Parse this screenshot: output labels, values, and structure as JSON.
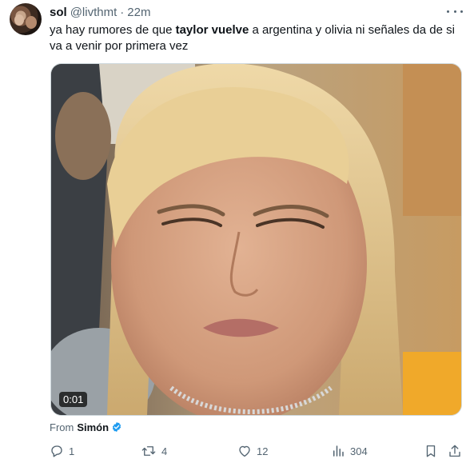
{
  "tweet": {
    "display_name": "sol",
    "handle": "@livthmt",
    "separator": "·",
    "time": "22m",
    "text": {
      "part1": "ya hay rumores de que ",
      "bold": "taylor vuelve",
      "part2": " a argentina y olivia ni señales da de si va a venir por primera vez"
    },
    "media": {
      "duration": "0:01"
    },
    "from": {
      "prefix": "From",
      "source": "Simón"
    },
    "actions": {
      "replies": "1",
      "reposts": "4",
      "likes": "12",
      "views": "304"
    },
    "icons": {
      "more": "more-horizontal-icon",
      "verified": "verified-badge-icon",
      "reply": "reply-icon",
      "repost": "repost-icon",
      "like": "heart-icon",
      "views": "views-chart-icon",
      "bookmark": "bookmark-icon",
      "share": "share-icon"
    },
    "colors": {
      "text": "#0f1419",
      "secondary": "#536471",
      "verified": "#1d9bf0",
      "border": "#cfd9de"
    }
  }
}
